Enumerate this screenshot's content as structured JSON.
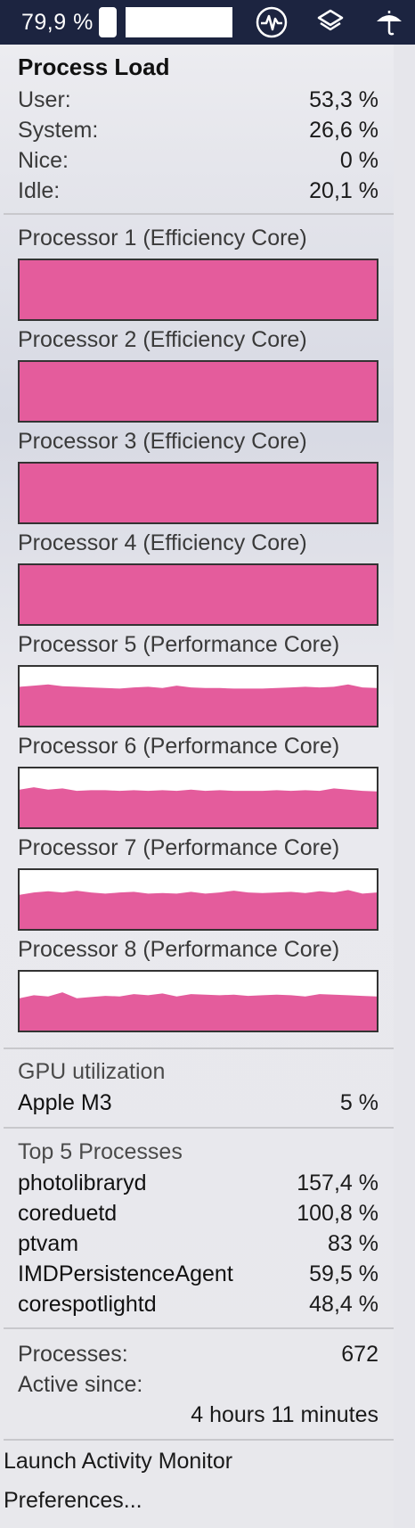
{
  "menubar": {
    "battery_percent": "79,9 %",
    "icons": [
      "battery-icon",
      "activity-pulse-icon",
      "layers-icon",
      "umbrella-icon"
    ]
  },
  "process_load": {
    "title": "Process Load",
    "rows": [
      {
        "label": "User:",
        "value": "53,3 %"
      },
      {
        "label": "System:",
        "value": "26,6 %"
      },
      {
        "label": "Nice:",
        "value": "0 %"
      },
      {
        "label": "Idle:",
        "value": "20,1 %"
      }
    ]
  },
  "processors": [
    {
      "label": "Processor 1 (Efficiency Core)",
      "load": [
        1,
        1,
        1,
        1,
        1,
        1,
        1,
        1,
        1,
        1,
        1,
        1,
        1,
        1,
        1,
        1,
        1,
        1,
        1,
        1,
        1,
        1,
        1,
        1,
        1,
        1
      ]
    },
    {
      "label": "Processor 2 (Efficiency Core)",
      "load": [
        1,
        1,
        1,
        1,
        1,
        1,
        1,
        1,
        1,
        1,
        1,
        1,
        1,
        1,
        1,
        1,
        1,
        1,
        1,
        1,
        1,
        1,
        1,
        1,
        1,
        1
      ]
    },
    {
      "label": "Processor 3 (Efficiency Core)",
      "load": [
        1,
        1,
        1,
        1,
        1,
        1,
        1,
        1,
        1,
        1,
        1,
        1,
        1,
        1,
        1,
        1,
        1,
        1,
        1,
        1,
        1,
        1,
        1,
        1,
        1,
        1
      ]
    },
    {
      "label": "Processor 4 (Efficiency Core)",
      "load": [
        1,
        1,
        1,
        1,
        1,
        1,
        1,
        1,
        1,
        1,
        1,
        1,
        1,
        1,
        1,
        1,
        1,
        1,
        1,
        1,
        1,
        1,
        1,
        1,
        1,
        1
      ]
    },
    {
      "label": "Processor 5 (Performance Core)",
      "load": [
        0.66,
        0.68,
        0.7,
        0.67,
        0.66,
        0.65,
        0.64,
        0.63,
        0.65,
        0.66,
        0.64,
        0.68,
        0.65,
        0.64,
        0.64,
        0.63,
        0.63,
        0.63,
        0.64,
        0.65,
        0.66,
        0.65,
        0.66,
        0.7,
        0.65,
        0.64
      ]
    },
    {
      "label": "Processor 6 (Performance Core)",
      "load": [
        0.64,
        0.68,
        0.64,
        0.66,
        0.62,
        0.63,
        0.63,
        0.62,
        0.63,
        0.62,
        0.63,
        0.62,
        0.64,
        0.62,
        0.63,
        0.62,
        0.62,
        0.62,
        0.63,
        0.62,
        0.63,
        0.62,
        0.66,
        0.64,
        0.62,
        0.61
      ]
    },
    {
      "label": "Processor 7 (Performance Core)",
      "load": [
        0.58,
        0.62,
        0.64,
        0.62,
        0.65,
        0.62,
        0.6,
        0.62,
        0.63,
        0.6,
        0.61,
        0.6,
        0.63,
        0.6,
        0.62,
        0.65,
        0.62,
        0.61,
        0.62,
        0.63,
        0.61,
        0.64,
        0.62,
        0.66,
        0.6,
        0.62
      ]
    },
    {
      "label": "Processor 8 (Performance Core)",
      "load": [
        0.55,
        0.6,
        0.58,
        0.65,
        0.55,
        0.57,
        0.59,
        0.58,
        0.62,
        0.6,
        0.63,
        0.58,
        0.62,
        0.61,
        0.6,
        0.61,
        0.59,
        0.6,
        0.61,
        0.6,
        0.58,
        0.62,
        0.61,
        0.6,
        0.59,
        0.58
      ]
    }
  ],
  "graph_color": "#e45c9c",
  "gpu": {
    "section_label": "GPU utilization",
    "name": "Apple M3",
    "value": "5 %"
  },
  "top_processes": {
    "section_label": "Top 5 Processes",
    "items": [
      {
        "name": "photolibraryd",
        "value": "157,4 %"
      },
      {
        "name": "coreduetd",
        "value": "100,8 %"
      },
      {
        "name": "ptvam",
        "value": "83 %"
      },
      {
        "name": "IMDPersistenceAgent",
        "value": "59,5 %"
      },
      {
        "name": "corespotlightd",
        "value": "48,4 %"
      }
    ]
  },
  "stats": {
    "processes_label": "Processes:",
    "processes_value": "672",
    "active_since_label": "Active since:",
    "active_since_value": "4 hours 11 minutes"
  },
  "menu": {
    "launch_activity_monitor": "Launch Activity Monitor",
    "preferences": "Preferences..."
  }
}
